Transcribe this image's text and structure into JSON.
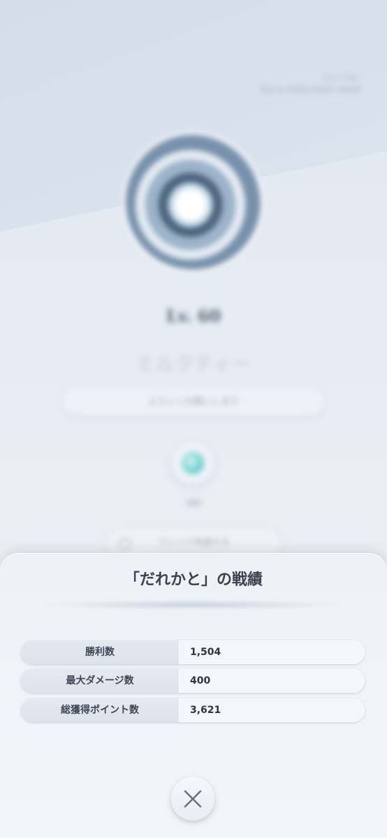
{
  "background_profile": {
    "friend_id_label": "フレンドID",
    "friend_id": "0213-4035-8297-4449",
    "level": "Lv. 60",
    "player_name": "ミルクティー",
    "greeting": "よろしくお願いします",
    "planet_label": "地球",
    "friend_button_label": "フレンド申請する"
  },
  "stats_sheet": {
    "title": "「だれかと」の戦績",
    "rows": [
      {
        "label": "勝利数",
        "value": "1,504"
      },
      {
        "label": "最大ダメージ数",
        "value": "400"
      },
      {
        "label": "総獲得ポイント数",
        "value": "3,621"
      }
    ],
    "close_icon": "close-x-icon"
  },
  "colors": {
    "sheet_bg": "#eef2f7",
    "text_dark": "#3a4150",
    "icon_gray": "#6b7482"
  }
}
